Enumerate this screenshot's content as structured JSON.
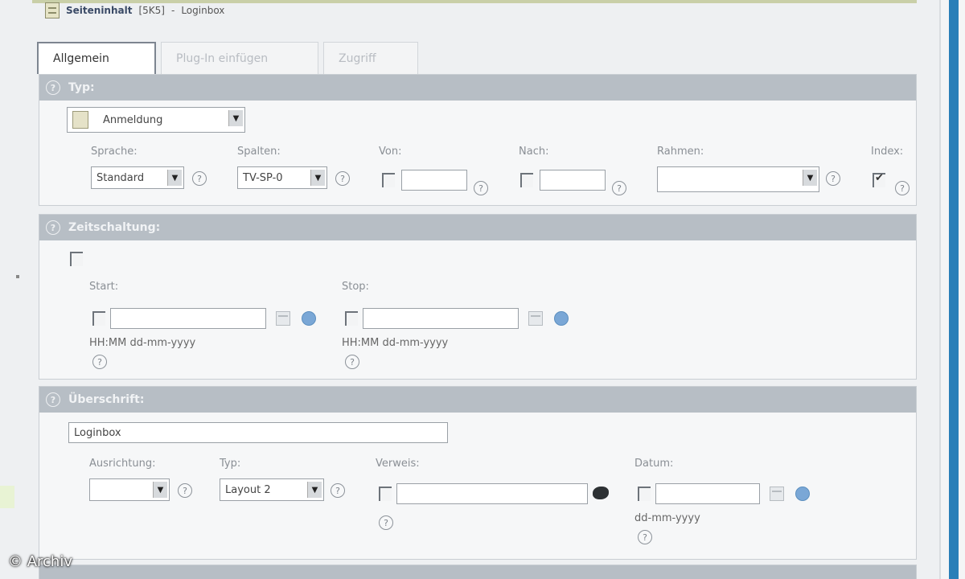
{
  "header": {
    "title": "Seiteninhalt",
    "id": "[5K5]",
    "separator": "-",
    "subtitle": "Loginbox"
  },
  "tabs": [
    {
      "label": "Allgemein",
      "active": true
    },
    {
      "label": "Plug-In einfügen",
      "active": false
    },
    {
      "label": "Zugriff",
      "active": false
    }
  ],
  "typ": {
    "heading": "Typ:",
    "type_select": "Anmeldung",
    "labels": {
      "sprache": "Sprache:",
      "spalten": "Spalten:",
      "von": "Von:",
      "nach": "Nach:",
      "rahmen": "Rahmen:",
      "index": "Index:"
    },
    "sprache_value": "Standard",
    "spalten_value": "TV-SP-0",
    "rahmen_value": "",
    "index_checked": true
  },
  "zeitschalt": {
    "heading": "Zeitschaltung:",
    "start_label": "Start:",
    "stop_label": "Stop:",
    "start_hint": "HH:MM dd-mm-yyyy",
    "stop_hint": "HH:MM dd-mm-yyyy"
  },
  "ueberschrift": {
    "heading": "Überschrift:",
    "title_value": "Loginbox",
    "labels": {
      "ausrichtung": "Ausrichtung:",
      "typ": "Typ:",
      "verweis": "Verweis:",
      "datum": "Datum:"
    },
    "ausrichtung_value": "",
    "typ_value": "Layout 2",
    "datum_hint": "dd-mm-yyyy"
  },
  "help_glyph": "?",
  "dropdown_arrow": "▼",
  "copyright": "© Archiv",
  "colors": {
    "section_header": "#b7bec5",
    "accent_bar": "#2a7fb8",
    "background": "#eef0f2"
  }
}
